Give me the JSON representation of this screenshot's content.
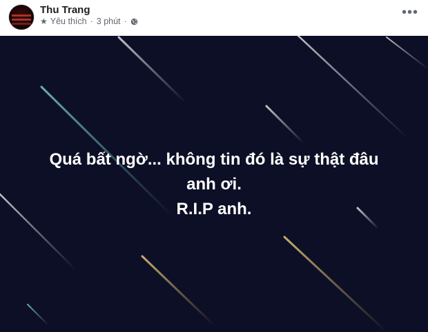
{
  "author": {
    "name": "Thu Trang"
  },
  "meta": {
    "relation": "Yêu thích",
    "time": "3 phút",
    "separator": "·"
  },
  "icons": {
    "star": "star-icon",
    "privacy": "globe-icon",
    "more": "more-options-icon"
  },
  "post": {
    "line1": "Quá bất ngờ... không tin đó là sự thật đâu",
    "line2": "anh ơi.",
    "line3": "R.I.P anh."
  },
  "colors": {
    "background": "#0d0f26",
    "text": "#ffffff"
  }
}
